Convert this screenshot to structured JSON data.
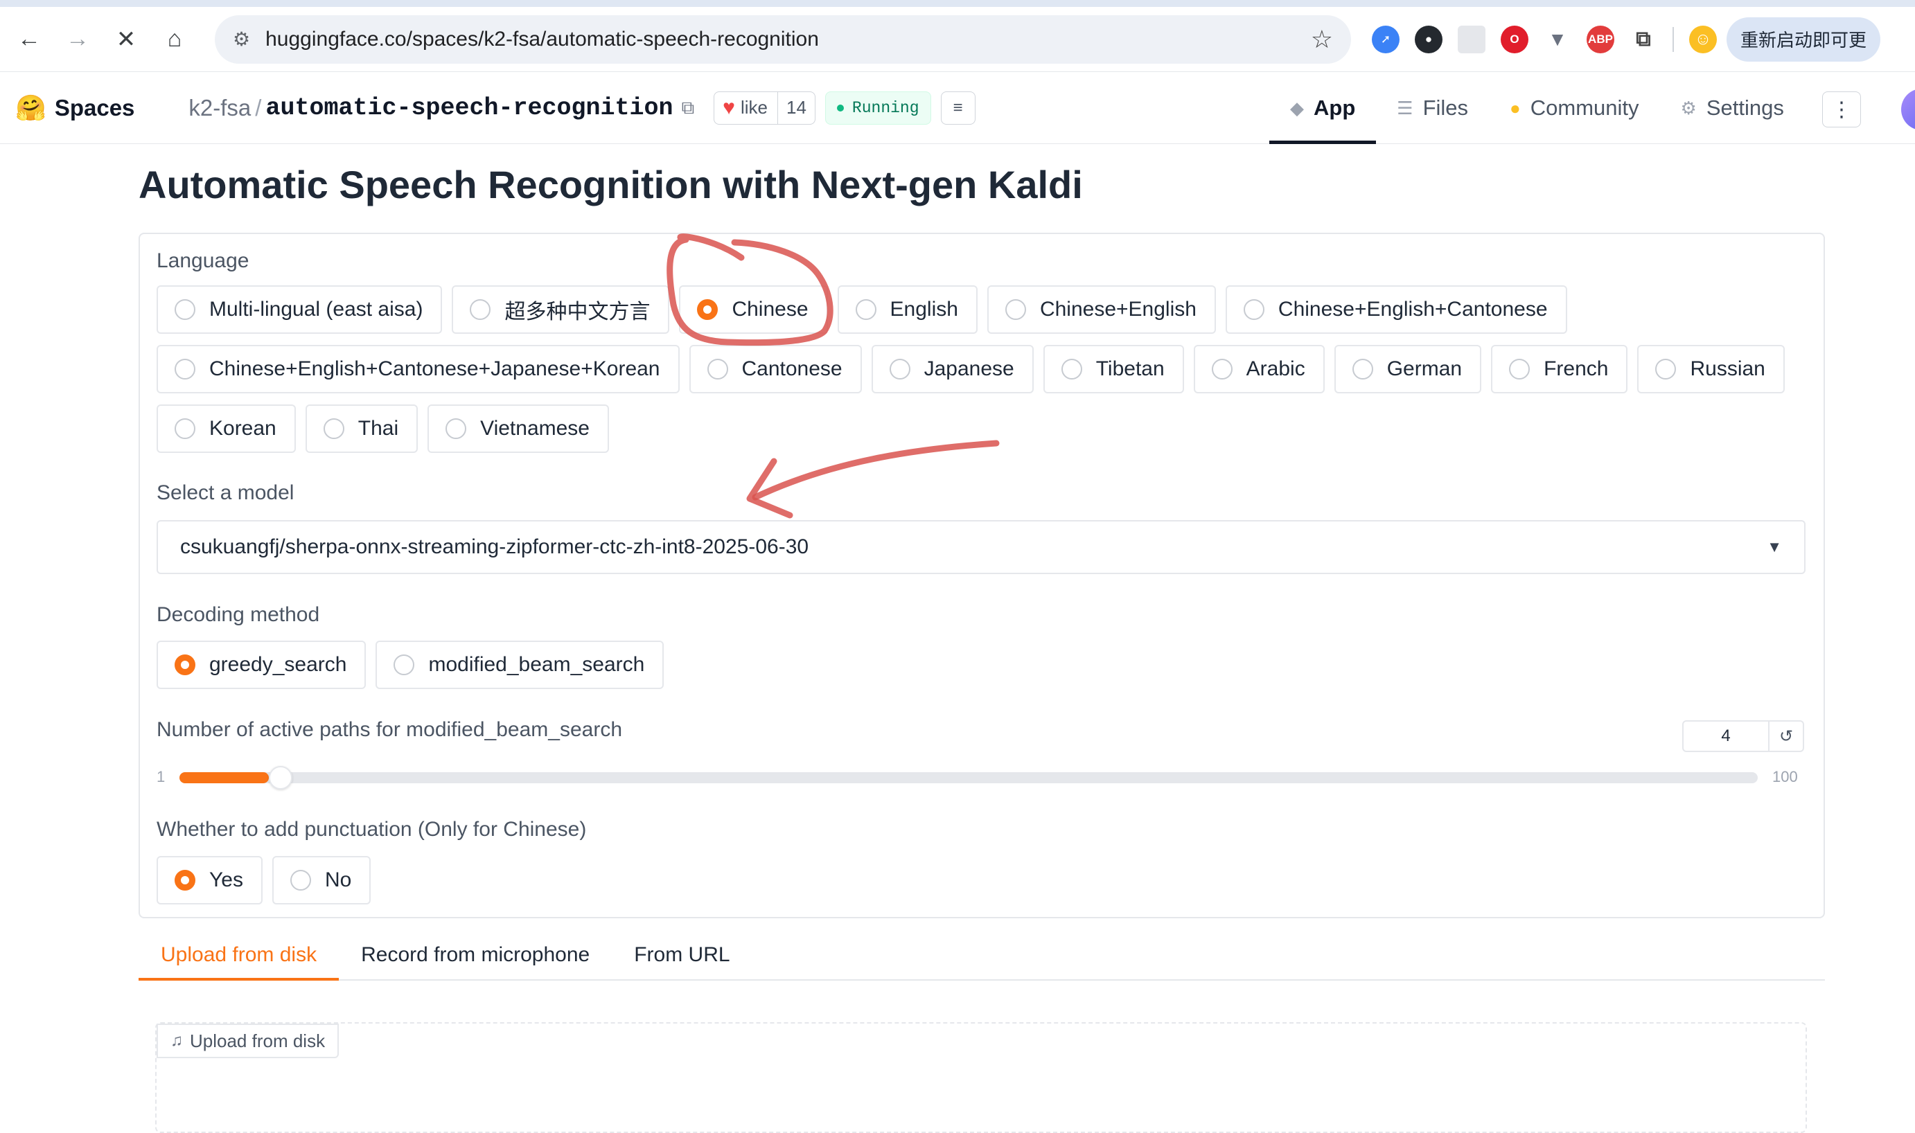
{
  "browser": {
    "url": "huggingface.co/spaces/k2-fsa/automatic-speech-recognition",
    "restart_label": "重新启动即可更"
  },
  "header": {
    "spaces_label": "Spaces",
    "owner": "k2-fsa",
    "repo": "automatic-speech-recognition",
    "like_label": "like",
    "like_count": "14",
    "status": "Running",
    "tabs": [
      {
        "label": "App",
        "icon": "app-cube-icon"
      },
      {
        "label": "Files",
        "icon": "files-icon"
      },
      {
        "label": "Community",
        "icon": "community-icon"
      },
      {
        "label": "Settings",
        "icon": "gear-icon"
      }
    ]
  },
  "app": {
    "title": "Automatic Speech Recognition with Next-gen Kaldi",
    "language_label": "Language",
    "languages": [
      "Multi-lingual (east aisa)",
      "超多种中文方言",
      "Chinese",
      "English",
      "Chinese+English",
      "Chinese+English+Cantonese",
      "Chinese+English+Cantonese+Japanese+Korean",
      "Cantonese",
      "Japanese",
      "Tibetan",
      "Arabic",
      "German",
      "French",
      "Russian",
      "Korean",
      "Thai",
      "Vietnamese"
    ],
    "selected_language": "Chinese",
    "model_label": "Select a model",
    "model_value": "csukuangfj/sherpa-onnx-streaming-zipformer-ctc-zh-int8-2025-06-30",
    "decoding_label": "Decoding method",
    "decoding_options": [
      "greedy_search",
      "modified_beam_search"
    ],
    "selected_decoding": "greedy_search",
    "paths_label": "Number of active paths for modified_beam_search",
    "paths_value": "4",
    "paths_min": "1",
    "paths_max": "100",
    "paths_fraction": 0.0303,
    "punct_label": "Whether to add punctuation (Only for Chinese)",
    "punct_options": [
      "Yes",
      "No"
    ],
    "selected_punct": "Yes",
    "input_tabs": [
      "Upload from disk",
      "Record from microphone",
      "From URL"
    ],
    "active_input_tab": "Upload from disk",
    "upload_label": "Upload from disk"
  },
  "colors": {
    "accent": "#f97316",
    "annotation": "#d9534f"
  }
}
